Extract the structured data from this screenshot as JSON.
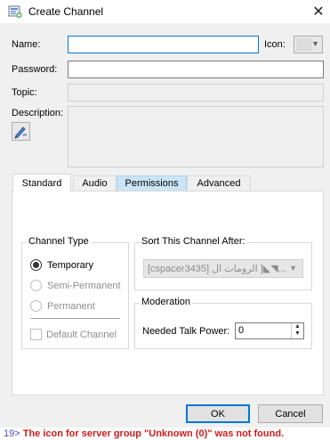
{
  "window": {
    "title": "Create Channel",
    "close_glyph": "✕"
  },
  "form": {
    "name_label": "Name:",
    "name_value": "",
    "icon_label": "Icon:",
    "password_label": "Password:",
    "password_value": "",
    "topic_label": "Topic:",
    "topic_value": "",
    "description_label": "Description:"
  },
  "tabs": [
    {
      "label": "Standard",
      "active": true
    },
    {
      "label": "Audio",
      "active": false
    },
    {
      "label": "Permissions",
      "active": false,
      "hover": true
    },
    {
      "label": "Advanced",
      "active": false
    }
  ],
  "channel_type": {
    "title": "Channel Type",
    "options": [
      {
        "label": "Temporary",
        "checked": true,
        "enabled": true
      },
      {
        "label": "Semi-Permanent",
        "checked": false,
        "enabled": false
      },
      {
        "label": "Permanent",
        "checked": false,
        "enabled": false
      }
    ],
    "default_channel_label": "Default Channel",
    "default_channel_checked": false
  },
  "sort": {
    "title": "Sort This Channel After:",
    "selected": "[cspacer3435] ﻿﻿﻿﻿الرومات ال ]◣◥..."
  },
  "moderation": {
    "title": "Moderation",
    "talk_power_label": "Needed Talk Power:",
    "talk_power_value": "0"
  },
  "buttons": {
    "ok": "OK",
    "cancel": "Cancel"
  },
  "background_log": {
    "prefix": "19>",
    "message": "The icon for server group \"Unknown (0)\" was not found."
  },
  "colors": {
    "focus_border": "#0078d7",
    "error_text": "#d01b1b",
    "tab_hover": "#cce4f7"
  }
}
